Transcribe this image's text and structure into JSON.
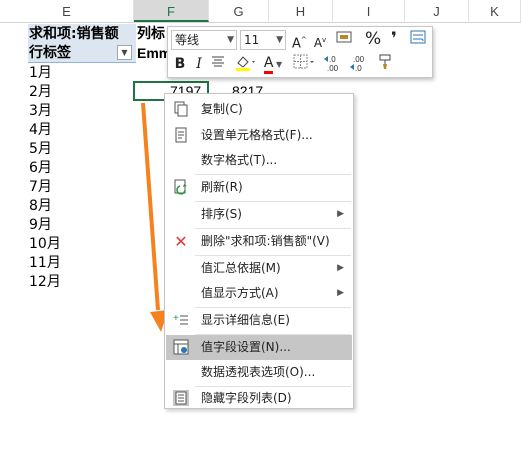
{
  "columns": [
    "E",
    "F",
    "G",
    "H",
    "I",
    "J",
    "K"
  ],
  "grid": {
    "header_row1": "求和项:销售额",
    "col_label": "列标",
    "header_row2": "行标签",
    "emm": "Emm",
    "months": [
      "1月",
      "2月",
      "3月",
      "4月",
      "5月",
      "6月",
      "7月",
      "8月",
      "9月",
      "10月",
      "11月",
      "12月"
    ],
    "value_f": "7197",
    "value_g": "8217"
  },
  "mini_toolbar": {
    "font_name": "等线",
    "font_size": "11",
    "grow_font": "A",
    "shrink_font": "A",
    "percent": "%",
    "comma": "❜",
    "bold": "B",
    "italic": "I",
    "font_color_letter": "A",
    "accent_yellow": "#ffff00",
    "accent_red": "#ff0000"
  },
  "menu": {
    "items": [
      {
        "label": "复制(C)",
        "icon": "copy-icon"
      },
      {
        "label": "设置单元格格式(F)...",
        "icon": "format-cells-icon"
      },
      {
        "label": "数字格式(T)...",
        "icon": ""
      },
      {
        "label": "刷新(R)",
        "icon": "refresh-icon"
      },
      {
        "label": "排序(S)",
        "icon": "",
        "submenu": true
      },
      {
        "label": "删除\"求和项:销售额\"(V)",
        "icon": "delete-icon"
      },
      {
        "label": "值汇总依据(M)",
        "icon": "",
        "submenu": true
      },
      {
        "label": "值显示方式(A)",
        "icon": "",
        "submenu": true
      },
      {
        "label": "显示详细信息(E)",
        "icon": "show-details-icon"
      },
      {
        "label": "值字段设置(N)...",
        "icon": "field-settings-icon",
        "highlighted": true
      },
      {
        "label": "数据透视表选项(O)...",
        "icon": ""
      },
      {
        "label": "隐藏字段列表(D)",
        "icon": "field-list-icon"
      }
    ]
  },
  "accent_orange": "#f5821f",
  "selection_green": "#217346"
}
